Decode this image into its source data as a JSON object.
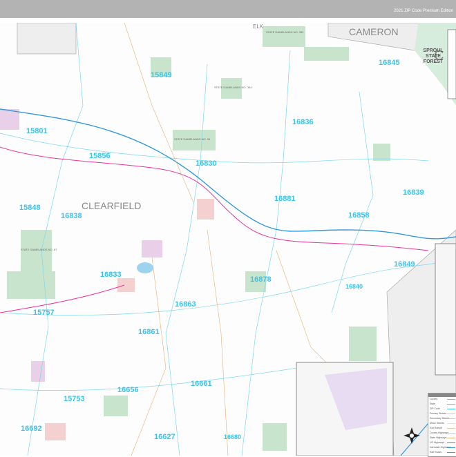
{
  "header": {
    "title": "2021 ZIP Code Premium Edition"
  },
  "places": {
    "county": "CLEARFIELD",
    "cameron": "CAMERON",
    "elk": "ELK",
    "c_partial": "C"
  },
  "zips": [
    "15849",
    "15801",
    "15856",
    "16830",
    "16836",
    "16845",
    "16839",
    "16881",
    "16858",
    "15848",
    "16838",
    "16849",
    "16833",
    "16878",
    "16840",
    "16863",
    "15757",
    "16861",
    "16661",
    "16656",
    "15753",
    "16692",
    "16627",
    "16680"
  ],
  "state_lands": [
    "STATE GAMELANDS NO. 331",
    "STATE GAMELANDS NO. 334",
    "STATE GAMELANDS NO. 94",
    "STATE GAMELANDS NO. 87",
    "SPROUL STATE FOREST"
  ],
  "legend": [
    {
      "label": "County",
      "color": "#aaaaaa"
    },
    {
      "label": "State",
      "color": "#66cc66"
    },
    {
      "label": "ZIP Code",
      "color": "#33c6f0"
    },
    {
      "label": "Primary Streets",
      "color": "#cccccc"
    },
    {
      "label": "Secondary Streets",
      "color": "#cccccc"
    },
    {
      "label": "Minor Streets",
      "color": "#dddddd"
    },
    {
      "label": "Exit Ramps",
      "color": "#e8c8a0"
    },
    {
      "label": "County Highways",
      "color": "#cccccc"
    },
    {
      "label": "State Highways",
      "color": "#e8b070"
    },
    {
      "label": "US Highways",
      "color": "#ee3399"
    },
    {
      "label": "Interstate Highways",
      "color": "#3399dd"
    },
    {
      "label": "Rail Roads",
      "color": "#44bb44"
    }
  ]
}
